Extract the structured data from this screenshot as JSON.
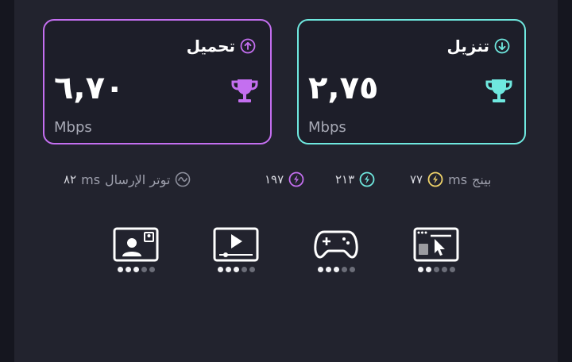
{
  "upload": {
    "title": "تحميل",
    "value": "٦,٧٠",
    "unit": "Mbps",
    "accent": "#c46ff0",
    "title_icon": "arrow-up-circle-icon",
    "badge_icon": "trophy-icon"
  },
  "download": {
    "title": "تنزيل",
    "value": "٢,٧٥",
    "unit": "Mbps",
    "accent": "#6fe8df",
    "title_icon": "arrow-down-circle-icon",
    "badge_icon": "trophy-icon"
  },
  "ping": {
    "label": "بينج",
    "unit": "ms",
    "values": [
      {
        "value": "٧٧",
        "color": "#f1d46a"
      },
      {
        "value": "٢١٣",
        "color": "#6fe8df"
      },
      {
        "value": "١٩٧",
        "color": "#c46ff0"
      }
    ]
  },
  "jitter": {
    "label": "توتر الإرسال",
    "unit": "ms",
    "value": "٨٢",
    "icon": "wave-circle-icon"
  },
  "activities": [
    {
      "icon": "video-call-icon",
      "rating": 3,
      "max": 5
    },
    {
      "icon": "video-streaming-icon",
      "rating": 3,
      "max": 5
    },
    {
      "icon": "gaming-controller-icon",
      "rating": 3,
      "max": 5
    },
    {
      "icon": "web-browsing-icon",
      "rating": 2,
      "max": 5
    }
  ]
}
